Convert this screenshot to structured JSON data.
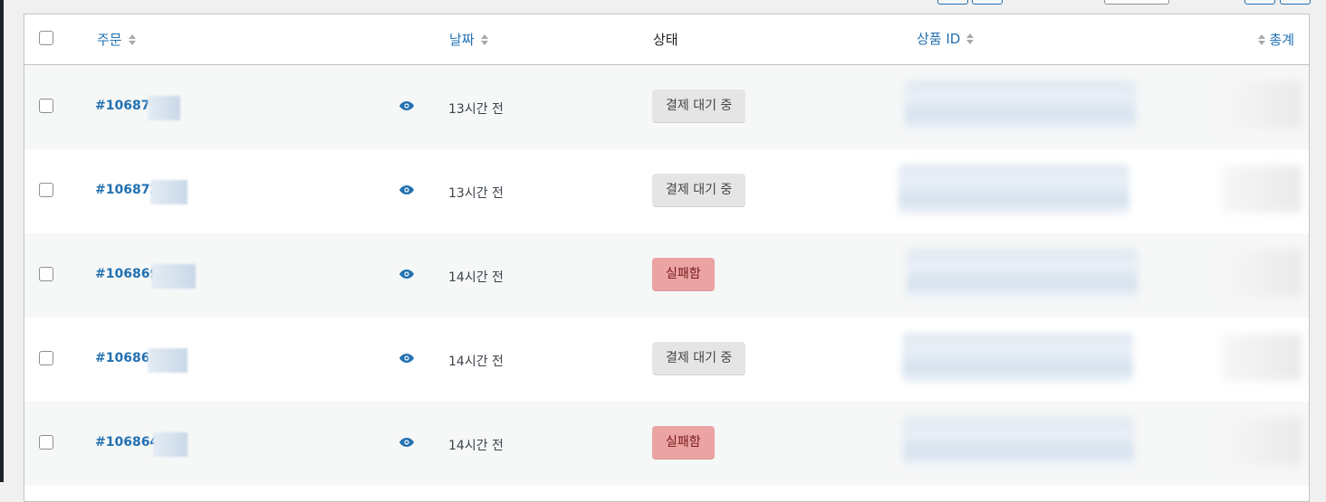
{
  "header": {
    "order": "주문",
    "date": "날짜",
    "status": "상태",
    "product_id": "상품 ID",
    "total": "총계"
  },
  "rows": [
    {
      "order": "#106875",
      "date": "13시간 전",
      "status": "결제 대기 중",
      "status_type": "pending"
    },
    {
      "order": "#106873",
      "date": "13시간 전",
      "status": "결제 대기 중",
      "status_type": "pending"
    },
    {
      "order": "#106869",
      "date": "14시간 전",
      "status": "실패함",
      "status_type": "failed"
    },
    {
      "order": "#106866",
      "date": "14시간 전",
      "status": "결제 대기 중",
      "status_type": "pending"
    },
    {
      "order": "#106864",
      "date": "14시간 전",
      "status": "실패함",
      "status_type": "failed"
    }
  ],
  "icons": {
    "preview": "eye-icon",
    "sort": "sort-arrows-icon"
  },
  "colors": {
    "link": "#2271b1",
    "pending_bg": "#e5e5e5",
    "failed_bg": "#eba3a3",
    "failed_text": "#761919",
    "alt_row": "#f6f7f7"
  }
}
